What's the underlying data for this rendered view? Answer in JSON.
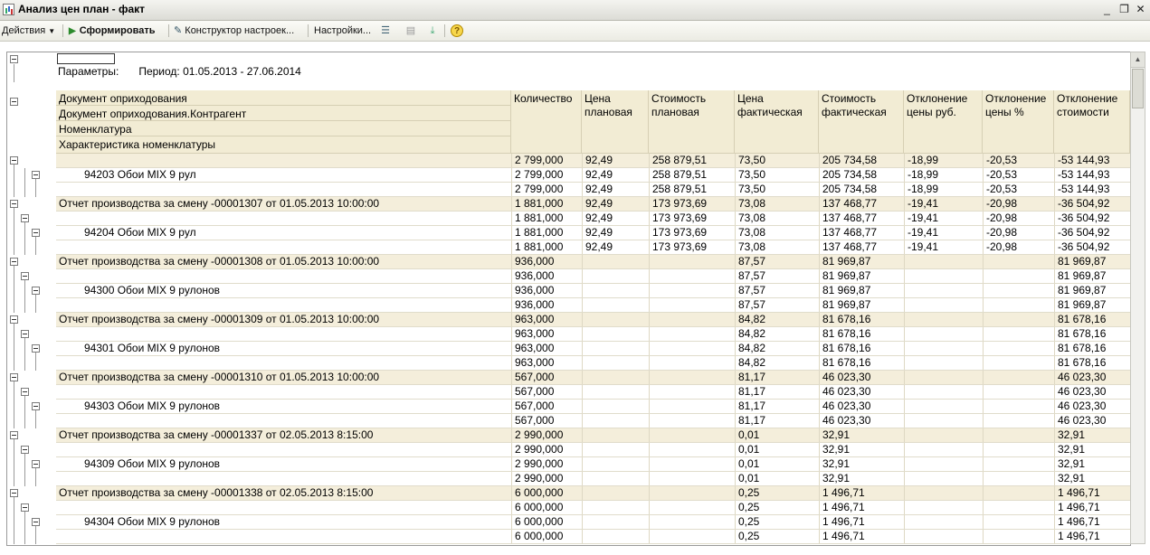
{
  "window": {
    "title": "Анализ цен план - факт",
    "minimize": "_",
    "restore": "❐",
    "close": "✕"
  },
  "toolbar": {
    "actions": "Действия",
    "generate": "Сформировать",
    "constructor": "Конструктор настроек...",
    "settings": "Настройки..."
  },
  "report": {
    "params_label": "Параметры:",
    "period": "Период: 01.05.2013 - 27.06.2014",
    "header_group_fields": [
      "Документ оприходования",
      "Документ оприходования.Контрагент",
      "Номенклатура",
      "Характеристика номенклатуры"
    ],
    "columns": [
      "Количество",
      "Цена плановая",
      "Стоимость плановая",
      "Цена фактическая",
      "Стоимость фактическая",
      "Отклонение цены руб.",
      "Отклонение цены %",
      "Отклонение стоимости"
    ],
    "rows": [
      {
        "label": "",
        "kind": "group",
        "v": [
          "2 799,000",
          "92,49",
          "258 879,51",
          "73,50",
          "205 734,58",
          "-18,99",
          "-20,53",
          "-53 144,93"
        ]
      },
      {
        "label": "94203  Обои MIX 9 рул",
        "kind": "item",
        "v": [
          "2 799,000",
          "92,49",
          "258 879,51",
          "73,50",
          "205 734,58",
          "-18,99",
          "-20,53",
          "-53 144,93"
        ]
      },
      {
        "label": "",
        "kind": "detail",
        "v": [
          "2 799,000",
          "92,49",
          "258 879,51",
          "73,50",
          "205 734,58",
          "-18,99",
          "-20,53",
          "-53 144,93"
        ]
      },
      {
        "label": "Отчет производства за смену      -00001307 от 01.05.2013 10:00:00",
        "kind": "group",
        "v": [
          "1 881,000",
          "92,49",
          "173 973,69",
          "73,08",
          "137 468,77",
          "-19,41",
          "-20,98",
          "-36 504,92"
        ]
      },
      {
        "label": "",
        "kind": "sub",
        "v": [
          "1 881,000",
          "92,49",
          "173 973,69",
          "73,08",
          "137 468,77",
          "-19,41",
          "-20,98",
          "-36 504,92"
        ]
      },
      {
        "label": "94204  Обои MIX  9 рул",
        "kind": "item",
        "v": [
          "1 881,000",
          "92,49",
          "173 973,69",
          "73,08",
          "137 468,77",
          "-19,41",
          "-20,98",
          "-36 504,92"
        ]
      },
      {
        "label": "",
        "kind": "detail",
        "v": [
          "1 881,000",
          "92,49",
          "173 973,69",
          "73,08",
          "137 468,77",
          "-19,41",
          "-20,98",
          "-36 504,92"
        ]
      },
      {
        "label": "Отчет производства за смену      -00001308 от 01.05.2013 10:00:00",
        "kind": "group",
        "v": [
          "936,000",
          "",
          "",
          "87,57",
          "81 969,87",
          "",
          "",
          "81 969,87"
        ]
      },
      {
        "label": "",
        "kind": "sub",
        "v": [
          "936,000",
          "",
          "",
          "87,57",
          "81 969,87",
          "",
          "",
          "81 969,87"
        ]
      },
      {
        "label": "94300  Обои MIX 9 рулонов",
        "kind": "item",
        "v": [
          "936,000",
          "",
          "",
          "87,57",
          "81 969,87",
          "",
          "",
          "81 969,87"
        ]
      },
      {
        "label": "",
        "kind": "detail",
        "v": [
          "936,000",
          "",
          "",
          "87,57",
          "81 969,87",
          "",
          "",
          "81 969,87"
        ]
      },
      {
        "label": "Отчет производства за смену      -00001309 от 01.05.2013 10:00:00",
        "kind": "group",
        "v": [
          "963,000",
          "",
          "",
          "84,82",
          "81 678,16",
          "",
          "",
          "81 678,16"
        ]
      },
      {
        "label": "",
        "kind": "sub",
        "v": [
          "963,000",
          "",
          "",
          "84,82",
          "81 678,16",
          "",
          "",
          "81 678,16"
        ]
      },
      {
        "label": "94301  Обои MIX 9 рулонов",
        "kind": "item",
        "v": [
          "963,000",
          "",
          "",
          "84,82",
          "81 678,16",
          "",
          "",
          "81 678,16"
        ]
      },
      {
        "label": "",
        "kind": "detail",
        "v": [
          "963,000",
          "",
          "",
          "84,82",
          "81 678,16",
          "",
          "",
          "81 678,16"
        ]
      },
      {
        "label": "Отчет производства за смену      -00001310 от 01.05.2013 10:00:00",
        "kind": "group",
        "v": [
          "567,000",
          "",
          "",
          "81,17",
          "46 023,30",
          "",
          "",
          "46 023,30"
        ]
      },
      {
        "label": "",
        "kind": "sub",
        "v": [
          "567,000",
          "",
          "",
          "81,17",
          "46 023,30",
          "",
          "",
          "46 023,30"
        ]
      },
      {
        "label": "94303  Обои MIX 9 рулонов",
        "kind": "item",
        "v": [
          "567,000",
          "",
          "",
          "81,17",
          "46 023,30",
          "",
          "",
          "46 023,30"
        ]
      },
      {
        "label": "",
        "kind": "detail",
        "v": [
          "567,000",
          "",
          "",
          "81,17",
          "46 023,30",
          "",
          "",
          "46 023,30"
        ]
      },
      {
        "label": "Отчет производства за смену      -00001337 от 02.05.2013 8:15:00",
        "kind": "group",
        "v": [
          "2 990,000",
          "",
          "",
          "0,01",
          "32,91",
          "",
          "",
          "32,91"
        ]
      },
      {
        "label": "",
        "kind": "sub",
        "v": [
          "2 990,000",
          "",
          "",
          "0,01",
          "32,91",
          "",
          "",
          "32,91"
        ]
      },
      {
        "label": "94309  Обои MIX 9 рулонов",
        "kind": "item",
        "v": [
          "2 990,000",
          "",
          "",
          "0,01",
          "32,91",
          "",
          "",
          "32,91"
        ]
      },
      {
        "label": "",
        "kind": "detail",
        "v": [
          "2 990,000",
          "",
          "",
          "0,01",
          "32,91",
          "",
          "",
          "32,91"
        ]
      },
      {
        "label": "Отчет производства за смену      -00001338 от 02.05.2013 8:15:00",
        "kind": "group",
        "v": [
          "6 000,000",
          "",
          "",
          "0,25",
          "1 496,71",
          "",
          "",
          "1 496,71"
        ]
      },
      {
        "label": "",
        "kind": "sub",
        "v": [
          "6 000,000",
          "",
          "",
          "0,25",
          "1 496,71",
          "",
          "",
          "1 496,71"
        ]
      },
      {
        "label": "94304  Обои MIX 9 рулонов",
        "kind": "item",
        "v": [
          "6 000,000",
          "",
          "",
          "0,25",
          "1 496,71",
          "",
          "",
          "1 496,71"
        ]
      },
      {
        "label": "",
        "kind": "detail",
        "v": [
          "6 000,000",
          "",
          "",
          "0,25",
          "1 496,71",
          "",
          "",
          "1 496,71"
        ]
      }
    ]
  }
}
